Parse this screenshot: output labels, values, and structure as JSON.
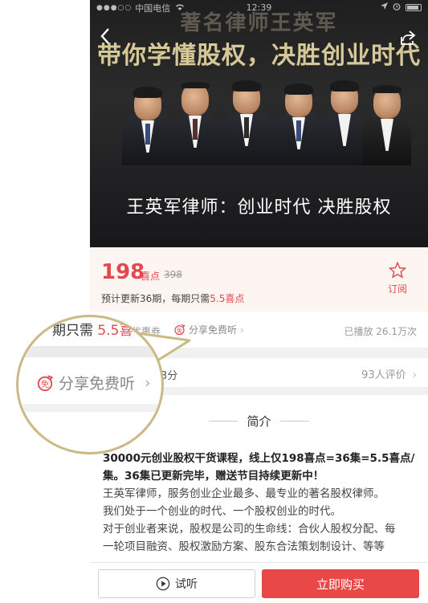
{
  "status_bar": {
    "signal": "●●●○○",
    "carrier": "中国电信",
    "wifi_icon": "wifi-icon",
    "time": "12:39"
  },
  "hero": {
    "top_title": "著名律师王英军",
    "title": "带你学懂股权，决胜创业时代",
    "subtitle": "王英军律师：创业时代 决胜股权"
  },
  "price": {
    "value": "198",
    "unit": "喜点",
    "original": "398",
    "update_prefix": "预计更新36期，每期只需",
    "update_value": "5.5喜点",
    "subscribe_label": "订阅"
  },
  "info_row": {
    "coupon": "优惠券",
    "share_label": "分享免费听",
    "plays": "已播放 26.1万次"
  },
  "rating_row": {
    "score": "3分",
    "reviews": "93人评价"
  },
  "intro": {
    "header": "简介",
    "bold_text": "30000元创业股权干货课程，线上仅198喜点=36集=5.5喜点/集。36集已更新完毕，赠送节目持续更新中！",
    "paragraphs": [
      "王英军律师，服务创业企业最多、最专业的著名股权律师。",
      "我们处于一个创业的时代、一个股权创业的时代。",
      "对于创业者来说，股权是公司的生命线：合伙人股权分配、每",
      "一轮项目融资、股权激励方案、股东合法策划制设计、等等"
    ]
  },
  "bottom": {
    "listen_label": "试听",
    "buy_label": "立即购买"
  },
  "magnifier": {
    "period_prefix": "期只需",
    "period_value": "5.5",
    "period_unit": "喜",
    "share_label": "分享免费听",
    "share_icon_char": "免"
  },
  "colors": {
    "accent_red": "#e5474f",
    "buy_button": "#e84848",
    "gold_title": "#d7c898",
    "magnifier_border": "#cbb986"
  }
}
